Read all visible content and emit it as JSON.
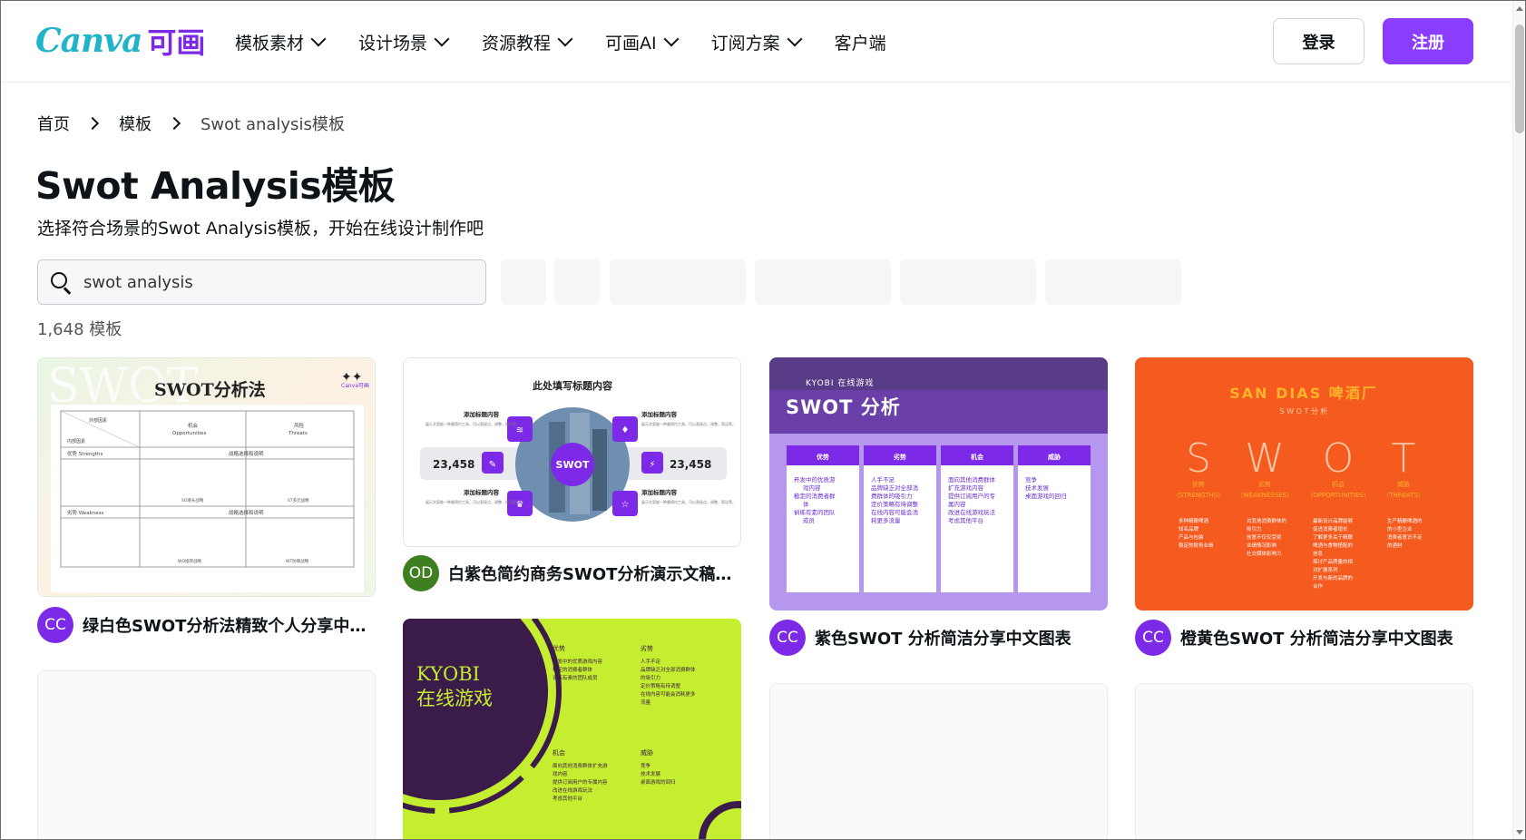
{
  "header": {
    "logo_text": "Canva",
    "logo_cn": "可画",
    "nav": [
      {
        "label": "模板素材"
      },
      {
        "label": "设计场景"
      },
      {
        "label": "资源教程"
      },
      {
        "label": "可画AI"
      },
      {
        "label": "订阅方案"
      },
      {
        "label": "客户端"
      }
    ],
    "login_label": "登录",
    "signup_label": "注册"
  },
  "breadcrumb": [
    "首页",
    "模板",
    "Swot analysis模板"
  ],
  "page": {
    "title": "Swot Analysis模板",
    "subtitle": "选择符合场景的Swot Analysis模板，开始在线设计制作吧",
    "count": "1,648 模板"
  },
  "search": {
    "value": "swot analysis"
  },
  "colors": {
    "brand": "#8b3dff",
    "accent": "#7d2ae8"
  },
  "cards": [
    {
      "title": "绿白色SWOT分析法精致个人分享中文...",
      "avatar": "CC",
      "preview": {
        "heading": "SWOT分析法",
        "watermark": "SWOT",
        "corner": "Canva可画",
        "r1": [
          "外部因素",
          "机会",
          "风险"
        ],
        "r1b": [
          "内部因素",
          "Opportunities",
          "Threats"
        ],
        "r2": [
          "优势 Strengths",
          "战略选择和说明"
        ],
        "r3": [
          "劣势 Weakness",
          "战略选择和说明"
        ],
        "small": [
          "SO增长战略",
          "ST多元战略",
          "WO扭转战略",
          "WT防御战略"
        ]
      }
    },
    {
      "title": "白紫色简约商务SWOT分析演示文稿结...",
      "avatar": "OD",
      "preview": {
        "heading": "此处填写标题内容",
        "center": "SWOT",
        "item": "添加标题内容",
        "num": "23,458",
        "body": "展示文案能一种最简约工具，可以直接点，调整，简洁等。"
      }
    },
    {
      "title": "紫色SWOT 分析简洁分享中文图表",
      "avatar": "CC",
      "preview": {
        "brand": "KYOBI 在线游戏",
        "heading": "SWOT 分析",
        "cols": [
          {
            "h": "优势",
            "items": [
              "开发中的优质游",
              "戏内容",
              "稳定的消费者群",
              "体",
              "训练有素的团队",
              "成员"
            ]
          },
          {
            "h": "劣势",
            "items": [
              "人手不足",
              "品牌缺乏对全部消",
              "费群体的吸引力",
              "定价策略有待调整",
              "在线内容可能会消",
              "耗更多流量"
            ]
          },
          {
            "h": "机会",
            "items": [
              "面向其他消费群体",
              "扩充游戏内容",
              "提供订阅用户的专",
              "属内容",
              "改进在线游戏玩法",
              "考虑其他平台"
            ]
          },
          {
            "h": "威胁",
            "items": [
              "竞争",
              "技术发展",
              "桌面游戏的回归"
            ]
          }
        ]
      }
    },
    {
      "title": "橙黄色SWOT 分析简洁分享中文图表",
      "avatar": "CC",
      "preview": {
        "brand": "SAN DIAS 啤酒厂",
        "sub": "S W O T  分 析",
        "letters": [
          "S",
          "W",
          "O",
          "T"
        ],
        "lcn": [
          "优势",
          "劣势",
          "机会",
          "威胁"
        ],
        "len": [
          "（STRENGTHS）",
          "（WEAKNESSES）",
          "（OPPORTUNITIES）",
          "（THREATS）"
        ],
        "items": [
          [
            "多种精酿啤酒",
            "知名品牌",
            "产品与包装",
            "稳定的财务业绩"
          ],
          [
            "对其他消费群体的",
            "吸引力",
            "创意不仅仅受到",
            "业绩情况影响",
            "社交媒体影响力"
          ],
          [
            "最新设计品牌能够",
            "促进消费者增长",
            "了解更多关于精酿",
            "啤酒与食物搭配的",
            "信息",
            "探讨产品质量的相",
            "对扩展系列",
            "开发与新的品牌的",
            "合作"
          ],
          [
            "生产精酿啤酒的",
            "的小型企业",
            "消费者意识不足",
            "的酒材"
          ]
        ]
      }
    },
    {
      "title": "",
      "avatar": "",
      "preview": {
        "brand1": "KYOBI",
        "brand2": "在线游戏",
        "q": [
          {
            "h": "优势",
            "items": [
              "开发中的优质游戏内容",
              "稳定的消费者群体",
              "训练有素的团队成员"
            ]
          },
          {
            "h": "劣势",
            "items": [
              "人手不足",
              "品牌缺乏对全部消费群体",
              "的吸引力",
              "定价策略有待调整",
              "在线内容可能会消耗更多",
              "流量"
            ]
          },
          {
            "h": "机会",
            "items": [
              "面向其他消费群体扩充游",
              "戏内容",
              "提供订阅用户的专属内容",
              "改进在线游戏玩法",
              "考虑其他平台"
            ]
          },
          {
            "h": "威胁",
            "items": [
              "竞争",
              "技术发展",
              "桌面游戏的回归"
            ]
          }
        ]
      }
    }
  ]
}
